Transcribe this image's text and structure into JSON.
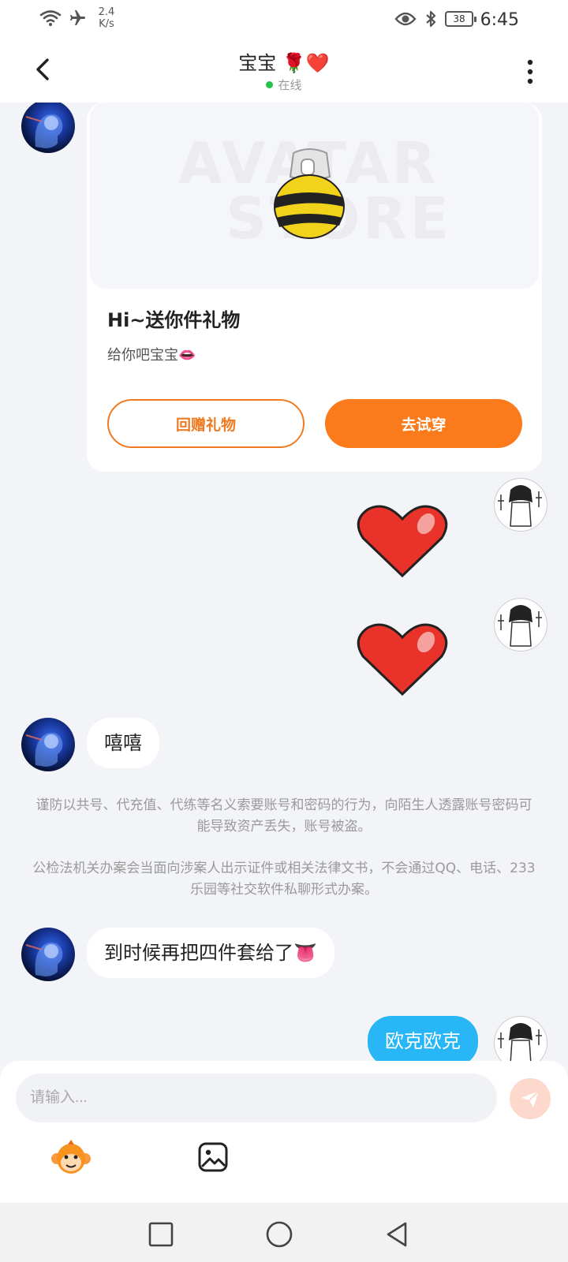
{
  "status_bar": {
    "net_speed_value": "2.4",
    "net_speed_unit": "K/s",
    "battery": "38",
    "time": "6:45",
    "icons": [
      "wifi-icon",
      "airplane-icon",
      "eye-icon",
      "bluetooth-icon",
      "battery-icon"
    ]
  },
  "header": {
    "title": "宝宝 🌹❤️",
    "status": "在线",
    "status_color": "#27c24c"
  },
  "gift_card": {
    "watermark_line1": "AVATAR",
    "watermark_line2": "STORE",
    "title": "Hi~送你件礼物",
    "subtitle": "给你吧宝宝👄",
    "return_gift_label": "回赠礼物",
    "try_on_label": "去试穿",
    "accent_color": "#fb7a1b"
  },
  "messages": [
    {
      "from": "them",
      "type": "gift"
    },
    {
      "from": "me",
      "type": "sticker",
      "sticker": "heart"
    },
    {
      "from": "me",
      "type": "sticker",
      "sticker": "heart"
    },
    {
      "from": "them",
      "type": "text",
      "text": "嘻嘻"
    },
    {
      "from": "me",
      "type": "text",
      "text": "欧克欧克"
    }
  ],
  "chat": {
    "msg_xixi": "嘻嘻",
    "notice_1": "谨防以共号、代充值、代练等名义索要账号和密码的行为，向陌生人透露账号密码可能导致资产丢失，账号被盗。",
    "notice_2": "公检法机关办案会当面向涉案人出示证件或相关法律文书，不会通过QQ、电话、233乐园等社交软件私聊形式办案。",
    "msg_four_piece": "到时候再把四件套给了👅",
    "msg_okay": "欧克欧克",
    "my_bubble_color": "#29b6f6"
  },
  "input": {
    "placeholder": "请输入..."
  }
}
